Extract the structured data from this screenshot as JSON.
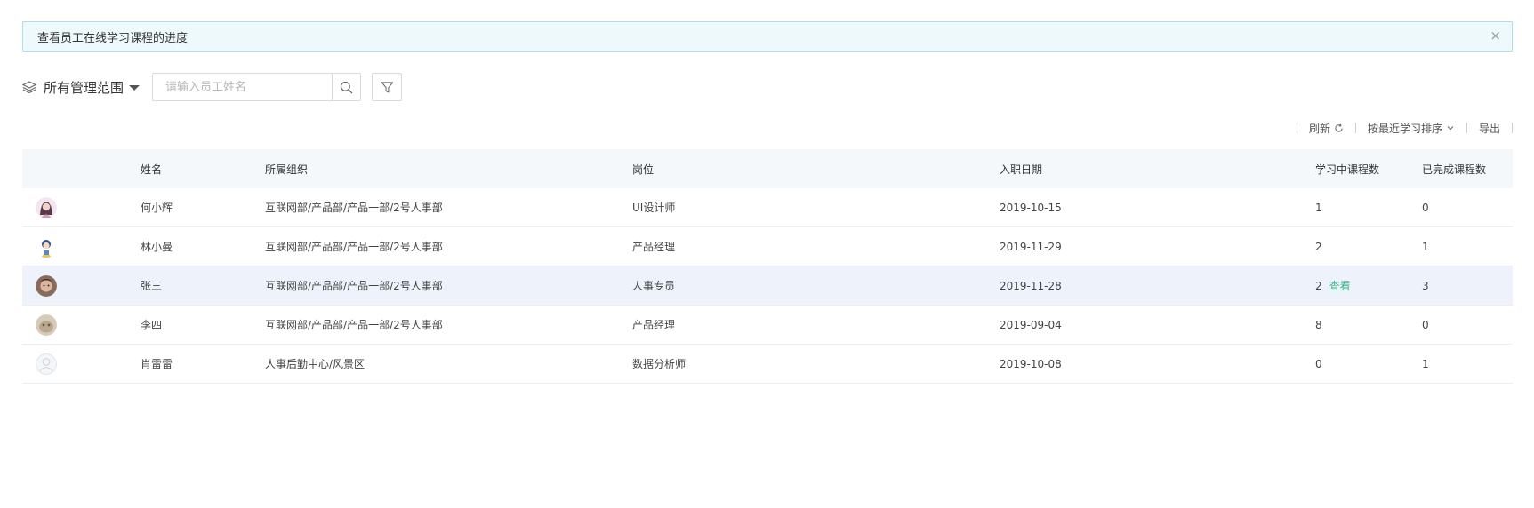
{
  "notice": {
    "text": "查看员工在线学习课程的进度",
    "close_symbol": "×"
  },
  "toolbar": {
    "scope_label": "所有管理范围",
    "search_placeholder": "请输入员工姓名",
    "search_icon": "search-icon",
    "filter_icon": "filter-icon"
  },
  "actions": {
    "refresh": "刷新",
    "sort": "按最近学习排序",
    "export": "导出"
  },
  "table": {
    "headers": [
      "",
      "姓名",
      "所属组织",
      "岗位",
      "入职日期",
      "学习中课程数",
      "已完成课程数"
    ],
    "rows": [
      {
        "name": "何小辉",
        "org": "互联网部/产品部/产品一部/2号人事部",
        "position": "UI设计师",
        "date": "2019-10-15",
        "learning": "1",
        "done": "0",
        "avatar_color": "#c9a0b8"
      },
      {
        "name": "林小曼",
        "org": "互联网部/产品部/产品一部/2号人事部",
        "position": "产品经理",
        "date": "2019-11-29",
        "learning": "2",
        "done": "1",
        "avatar_color": "#5a86c4"
      },
      {
        "name": "张三",
        "org": "互联网部/产品部/产品一部/2号人事部",
        "position": "人事专员",
        "date": "2019-11-28",
        "learning": "2",
        "done": "3",
        "avatar_color": "#8a6a5a",
        "view_label": "查看"
      },
      {
        "name": "李四",
        "org": "互联网部/产品部/产品一部/2号人事部",
        "position": "产品经理",
        "date": "2019-09-04",
        "learning": "8",
        "done": "0",
        "avatar_color": "#b8a890"
      },
      {
        "name": "肖雷雷",
        "org": "人事后勤中心/风景区",
        "position": "数据分析师",
        "date": "2019-10-08",
        "learning": "0",
        "done": "1",
        "avatar_color": "#e6e9ee"
      }
    ]
  },
  "colors": {
    "accent": "#3eb489",
    "notice_bg": "#eef9fc",
    "notice_border": "#a9dfee",
    "header_bg": "#f5f8fb",
    "highlight_row": "#eef3fb"
  }
}
